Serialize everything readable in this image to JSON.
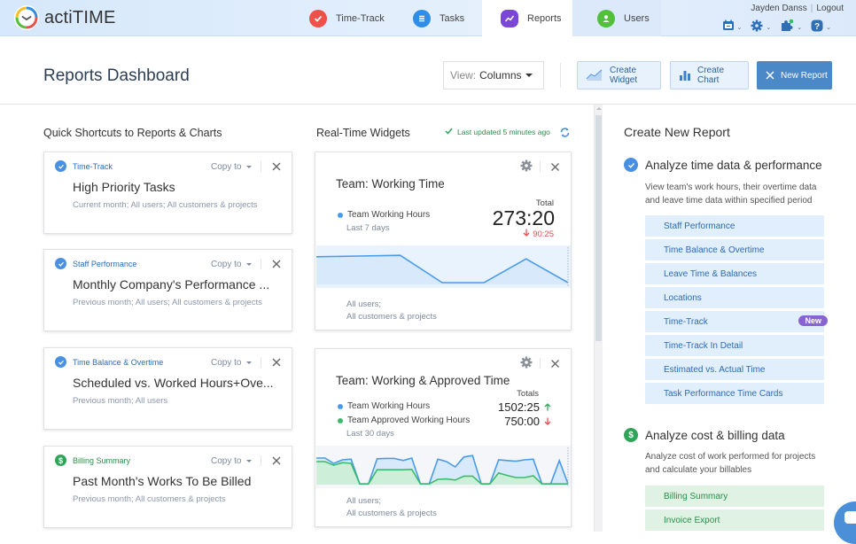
{
  "app": {
    "name": "actiTIME",
    "nav_tabs": [
      {
        "label": "Time-Track",
        "icon": "time-track-icon",
        "color": "#f0504a",
        "active": false
      },
      {
        "label": "Tasks",
        "icon": "tasks-icon",
        "color": "#2f8ee6",
        "active": false
      },
      {
        "label": "Reports",
        "icon": "reports-icon",
        "color": "#7b45d6",
        "active": true
      },
      {
        "label": "Users",
        "icon": "users-icon",
        "color": "#52bf3e",
        "active": false
      }
    ],
    "user_name": "Jayden Danss",
    "logout_label": "Logout",
    "tool_icons": [
      "calendar-icon",
      "gear-icon",
      "puzzle-icon",
      "help-icon"
    ]
  },
  "header": {
    "title": "Reports Dashboard",
    "view_label": "View:",
    "view_value": "Columns",
    "create_widget_label": "Create Widget",
    "create_chart_label": "Create Chart",
    "new_report_label": "New Report"
  },
  "shortcuts": {
    "title": "Quick Shortcuts to Reports & Charts",
    "copy_label": "Copy to",
    "items": [
      {
        "category": "Time-Track",
        "category_color": "#2c6bb5",
        "icon": "check-circle-icon",
        "title": "High Priority Tasks",
        "subtitle": "Current month; All users; All customers & projects"
      },
      {
        "category": "Staff Performance",
        "category_color": "#2c6bb5",
        "icon": "check-circle-icon",
        "title": "Monthly Company's Performance ...",
        "subtitle": "Previous month; All users; All customers & projects"
      },
      {
        "category": "Time Balance & Overtime",
        "category_color": "#2c6bb5",
        "icon": "check-circle-icon",
        "title": "Scheduled vs. Worked Hours+Ove...",
        "subtitle": "Previous month; All users"
      },
      {
        "category": "Billing Summary",
        "category_color": "#2f8d4b",
        "icon": "dollar-circle-icon",
        "title": "Past Month's Works To Be Billed",
        "subtitle": "Previous month; All customers & projects"
      }
    ]
  },
  "widgets": {
    "title": "Real-Time Widgets",
    "last_updated": "Last updated 5 minutes ago",
    "items": [
      {
        "title": "Team: Working Time",
        "total_label": "Total",
        "series": [
          {
            "name": "Team Working Hours",
            "color": "#4a9be8"
          }
        ],
        "period": "Last 7 days",
        "total_value": "273:20",
        "delta": "90:25",
        "delta_direction": "down",
        "footer_line1": "All users;",
        "footer_line2": "All customers & projects"
      },
      {
        "title": "Team: Working & Approved Time",
        "total_label": "Totals",
        "series": [
          {
            "name": "Team Working Hours",
            "color": "#4a9be8",
            "value": "1502:25",
            "direction": "up"
          },
          {
            "name": "Team Approved Working Hours",
            "color": "#3dbb6a",
            "value": "750:00",
            "direction": "down"
          }
        ],
        "period": "Last 30 days",
        "footer_line1": "All users;",
        "footer_line2": "All customers & projects"
      }
    ]
  },
  "chart_data": [
    {
      "type": "area",
      "title": "Team: Working Time",
      "x": [
        1,
        2,
        3,
        4,
        5,
        6,
        7
      ],
      "series": [
        {
          "name": "Team Working Hours",
          "values": [
            0.78,
            0.8,
            0.82,
            0.05,
            0.05,
            0.72,
            0.05
          ]
        }
      ],
      "ylim": [
        0,
        1
      ],
      "grid": false
    },
    {
      "type": "area",
      "title": "Team: Working & Approved Time",
      "x": [
        1,
        2,
        3,
        4,
        5,
        6,
        7,
        8,
        9,
        10,
        11,
        12,
        13,
        14,
        15,
        16,
        17,
        18,
        19,
        20,
        21,
        22,
        23,
        24,
        25,
        26,
        27,
        28,
        29,
        30
      ],
      "series": [
        {
          "name": "Team Working Hours",
          "values": [
            0.75,
            0.75,
            0.6,
            0.7,
            0.72,
            0.02,
            0.02,
            0.73,
            0.74,
            0.74,
            0.68,
            0.75,
            0.02,
            0.02,
            0.72,
            0.65,
            0.5,
            0.78,
            0.82,
            0.02,
            0.02,
            0.7,
            0.68,
            0.66,
            0.7,
            0.72,
            0.02,
            0.02,
            0.68,
            0.02
          ]
        },
        {
          "name": "Team Approved Working Hours",
          "values": [
            0.65,
            0.65,
            0.55,
            0.62,
            0.6,
            0.02,
            0.02,
            0.42,
            0.42,
            0.42,
            0.42,
            0.43,
            0.02,
            0.02,
            0.15,
            0.16,
            0.13,
            0.24,
            0.24,
            0.02,
            0.02,
            0.33,
            0.26,
            0.2,
            0.2,
            0.25,
            0.02,
            0.02,
            0.02,
            0.02
          ]
        }
      ],
      "ylim": [
        0,
        1
      ],
      "grid": false
    }
  ],
  "create_report": {
    "title": "Create New Report",
    "sections": [
      {
        "title": "Analyze time data & performance",
        "icon": "check-circle-icon",
        "color": "#4a90e2",
        "description_line1": "View team's work hours, their overtime data",
        "description_line2": "and leave time data within specified period",
        "items": [
          {
            "label": "Staff Performance"
          },
          {
            "label": "Time Balance & Overtime"
          },
          {
            "label": "Leave Time & Balances"
          },
          {
            "label": "Locations"
          },
          {
            "label": "Time-Track",
            "badge": "New"
          },
          {
            "label": "Time-Track In Detail"
          },
          {
            "label": "Estimated vs. Actual Time"
          },
          {
            "label": "Task Performance Time Cards"
          }
        ]
      },
      {
        "title": "Analyze cost & billing data",
        "icon": "dollar-circle-icon",
        "color": "#2fa55a",
        "description_line1": "Analyze cost of work performed for projects",
        "description_line2": "and calculate your billables",
        "items": [
          {
            "label": "Billing Summary"
          },
          {
            "label": "Invoice Export"
          }
        ]
      }
    ]
  }
}
